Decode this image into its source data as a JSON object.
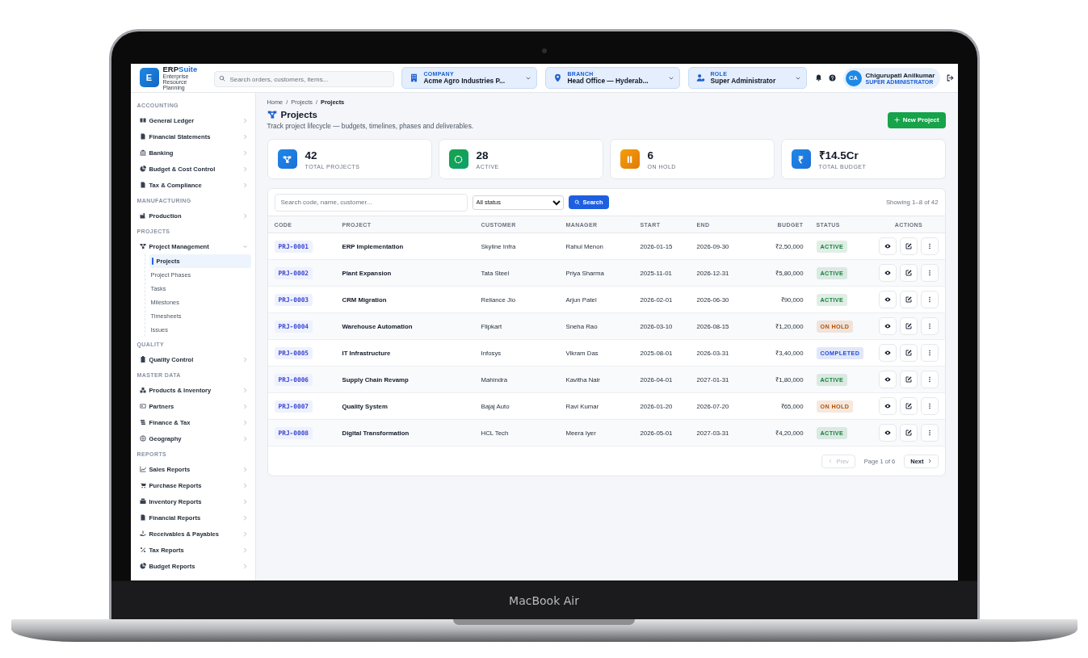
{
  "device": {
    "label": "MacBook Air"
  },
  "header": {
    "logo_letter": "E",
    "brand_main": "ERP",
    "brand_accent": "Suite",
    "tagline": "Enterprise Resource Planning",
    "search": {
      "placeholder": "Search orders, customers, items..."
    },
    "selectors": [
      {
        "kind": "company",
        "label": "COMPANY",
        "value": "Acme Agro Industries P..."
      },
      {
        "kind": "branch",
        "label": "BRANCH",
        "value": "Head Office — Hyderab..."
      },
      {
        "kind": "role",
        "label": "ROLE",
        "value": "Super Administrator"
      }
    ],
    "user": {
      "initials": "CA",
      "name": "Chigurupati Anilkumar",
      "role": "SUPER ADMINISTRATOR"
    }
  },
  "sidebar": {
    "sections": [
      {
        "label": "ACCOUNTING",
        "items": [
          {
            "label": "General Ledger",
            "expanded": false
          },
          {
            "label": "Financial Statements",
            "expanded": false
          },
          {
            "label": "Banking",
            "expanded": false
          },
          {
            "label": "Budget & Cost Control",
            "expanded": false
          },
          {
            "label": "Tax & Compliance",
            "expanded": false
          }
        ]
      },
      {
        "label": "MANUFACTURING",
        "items": [
          {
            "label": "Production",
            "expanded": false
          }
        ]
      },
      {
        "label": "PROJECTS",
        "items": [
          {
            "label": "Project Management",
            "expanded": true,
            "children": [
              {
                "label": "Projects",
                "selected": true
              },
              {
                "label": "Project Phases",
                "selected": false
              },
              {
                "label": "Tasks",
                "selected": false
              },
              {
                "label": "Milestones",
                "selected": false
              },
              {
                "label": "Timesheets",
                "selected": false
              },
              {
                "label": "Issues",
                "selected": false
              }
            ]
          }
        ]
      },
      {
        "label": "QUALITY",
        "items": [
          {
            "label": "Quality Control",
            "expanded": false
          }
        ]
      },
      {
        "label": "MASTER DATA",
        "items": [
          {
            "label": "Products & Inventory",
            "expanded": false
          },
          {
            "label": "Partners",
            "expanded": false
          },
          {
            "label": "Finance & Tax",
            "expanded": false
          },
          {
            "label": "Geography",
            "expanded": false
          }
        ]
      },
      {
        "label": "REPORTS",
        "items": [
          {
            "label": "Sales Reports",
            "expanded": false
          },
          {
            "label": "Purchase Reports",
            "expanded": false
          },
          {
            "label": "Inventory Reports",
            "expanded": false
          },
          {
            "label": "Financial Reports",
            "expanded": false
          },
          {
            "label": "Receivables & Payables",
            "expanded": false
          },
          {
            "label": "Tax Reports",
            "expanded": false
          },
          {
            "label": "Budget Reports",
            "expanded": false
          }
        ]
      }
    ]
  },
  "page": {
    "breadcrumb": {
      "separator": "/",
      "items": [
        {
          "label": "Home",
          "current": false
        },
        {
          "label": "Projects",
          "current": false
        },
        {
          "label": "Projects",
          "current": true
        }
      ]
    },
    "title": "Projects",
    "subtitle": "Track project lifecycle — budgets, timelines, phases and deliverables.",
    "new_button": "New Project"
  },
  "stats": [
    {
      "kind": "total",
      "value": "42",
      "label": "TOTAL PROJECTS"
    },
    {
      "kind": "active",
      "value": "28",
      "label": "ACTIVE"
    },
    {
      "kind": "hold",
      "value": "6",
      "label": "ON HOLD"
    },
    {
      "kind": "budget",
      "value": "₹14.5Cr",
      "label": "TOTAL BUDGET",
      "icon_text": "₹"
    }
  ],
  "table": {
    "search": {
      "placeholder": "Search code, name, customer..."
    },
    "status_filter": "All status",
    "search_button": "Search",
    "summary": "Showing 1–8 of 42",
    "columns": [
      "CODE",
      "PROJECT",
      "CUSTOMER",
      "MANAGER",
      "START",
      "END",
      "BUDGET",
      "STATUS",
      "ACTIONS"
    ],
    "rows": [
      {
        "code": "PRJ-0001",
        "project": "ERP Implementation",
        "customer": "Skyline Infra",
        "manager": "Rahul Menon",
        "start": "2026-01-15",
        "end": "2026-09-30",
        "budget": "₹2,50,000",
        "status": {
          "label": "ACTIVE",
          "color": "#15803d"
        }
      },
      {
        "code": "PRJ-0002",
        "project": "Plant Expansion",
        "customer": "Tata Steel",
        "manager": "Priya Sharma",
        "start": "2025-11-01",
        "end": "2026-12-31",
        "budget": "₹5,80,000",
        "status": {
          "label": "ACTIVE",
          "color": "#15803d"
        }
      },
      {
        "code": "PRJ-0003",
        "project": "CRM Migration",
        "customer": "Reliance Jio",
        "manager": "Arjun Patel",
        "start": "2026-02-01",
        "end": "2026-06-30",
        "budget": "₹90,000",
        "status": {
          "label": "ACTIVE",
          "color": "#15803d"
        }
      },
      {
        "code": "PRJ-0004",
        "project": "Warehouse Automation",
        "customer": "Flipkart",
        "manager": "Sneha Rao",
        "start": "2026-03-10",
        "end": "2026-08-15",
        "budget": "₹1,20,000",
        "status": {
          "label": "ON HOLD",
          "color": "#b45309"
        }
      },
      {
        "code": "PRJ-0005",
        "project": "IT Infrastructure",
        "customer": "Infosys",
        "manager": "Vikram Das",
        "start": "2025-08-01",
        "end": "2026-03-31",
        "budget": "₹3,40,000",
        "status": {
          "label": "COMPLETED",
          "color": "#1d4ed8"
        }
      },
      {
        "code": "PRJ-0006",
        "project": "Supply Chain Revamp",
        "customer": "Mahindra",
        "manager": "Kavitha Nair",
        "start": "2026-04-01",
        "end": "2027-01-31",
        "budget": "₹1,80,000",
        "status": {
          "label": "ACTIVE",
          "color": "#15803d"
        }
      },
      {
        "code": "PRJ-0007",
        "project": "Quality System",
        "customer": "Bajaj Auto",
        "manager": "Ravi Kumar",
        "start": "2026-01-20",
        "end": "2026-07-20",
        "budget": "₹65,000",
        "status": {
          "label": "ON HOLD",
          "color": "#b45309"
        }
      },
      {
        "code": "PRJ-0008",
        "project": "Digital Transformation",
        "customer": "HCL Tech",
        "manager": "Meera Iyer",
        "start": "2026-05-01",
        "end": "2027-03-31",
        "budget": "₹4,20,000",
        "status": {
          "label": "ACTIVE",
          "color": "#15803d"
        }
      }
    ]
  },
  "pagination": {
    "prev": {
      "label": "Prev",
      "disabled": true
    },
    "page_info": "Page 1 of 6",
    "next": {
      "label": "Next",
      "disabled": false
    }
  }
}
